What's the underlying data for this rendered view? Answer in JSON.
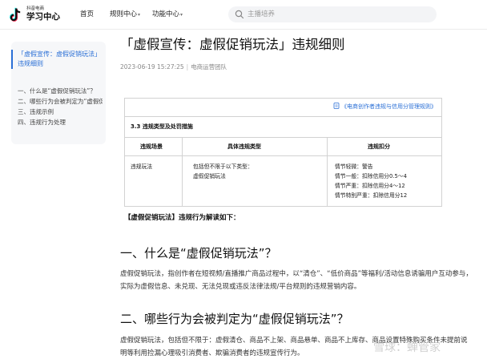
{
  "header": {
    "logo_small": "抖音电商",
    "logo_big": "学习中心",
    "nav": [
      {
        "label": "首页",
        "dropdown": false
      },
      {
        "label": "规则中心",
        "dropdown": true
      },
      {
        "label": "功能中心",
        "dropdown": true
      }
    ],
    "search_placeholder": "主播培养"
  },
  "toc": {
    "title": "「虚假宣传：虚假促销玩法」违规细则",
    "items": [
      "一、什么是“虚假促销玩法”？",
      "二、哪些行为会被判定为“虚假促销玩法”？",
      "三、违规示例",
      "四、违规行为处理"
    ]
  },
  "article": {
    "title": "「虚假宣传：虚假促销玩法」违规细则",
    "date": "2023-06-19 15:27:25",
    "author": "电商运营团队",
    "doc_link": "《电商创作者违规与信用分管理规则》",
    "section_title": "3.3 违规类型及处罚措施",
    "table_headers": [
      "违规场景",
      "具体违规类型",
      "违规扣分"
    ],
    "table_row": {
      "scene": "违规玩法",
      "types": [
        "包括但不限于以下类型：",
        "虚假促销玩法"
      ],
      "penalties": [
        "情节轻微：警告",
        "情节一般：扣除信用分0.5～4",
        "情节严重：扣除信用分4～12",
        "情节特别严重：扣除信用分12"
      ]
    },
    "lead": "【虚假促销玩法】违规行为解读如下：",
    "h2_1": "一、什么是“虚假促销玩法”？",
    "p1": "虚假促销玩法，指创作者在短视频/直播推广商品过程中，以“清仓”、“低价商品”等福利/活动信息诱骗用户互动参与，实际为虚假信息、未兑现、无法兑现或违反法律法规/平台规则的违规营销内容。",
    "h2_2": "二、哪些行为会被判定为“虚假促销玩法”？",
    "p2": "虚假促销玩法，包括但不限于：虚假清仓、商品不上架、商品悬单、商品不上库存、商品设置特殊购买条件未提前说明等利用捡漏心理吸引消费者、欺骗消费者的违规宣传行为。"
  },
  "watermark": "雪球：蝉管家",
  "colors": {
    "accent": "#2a6fd6",
    "logo_cyan": "#25f4ee",
    "logo_red": "#fe2c55"
  }
}
